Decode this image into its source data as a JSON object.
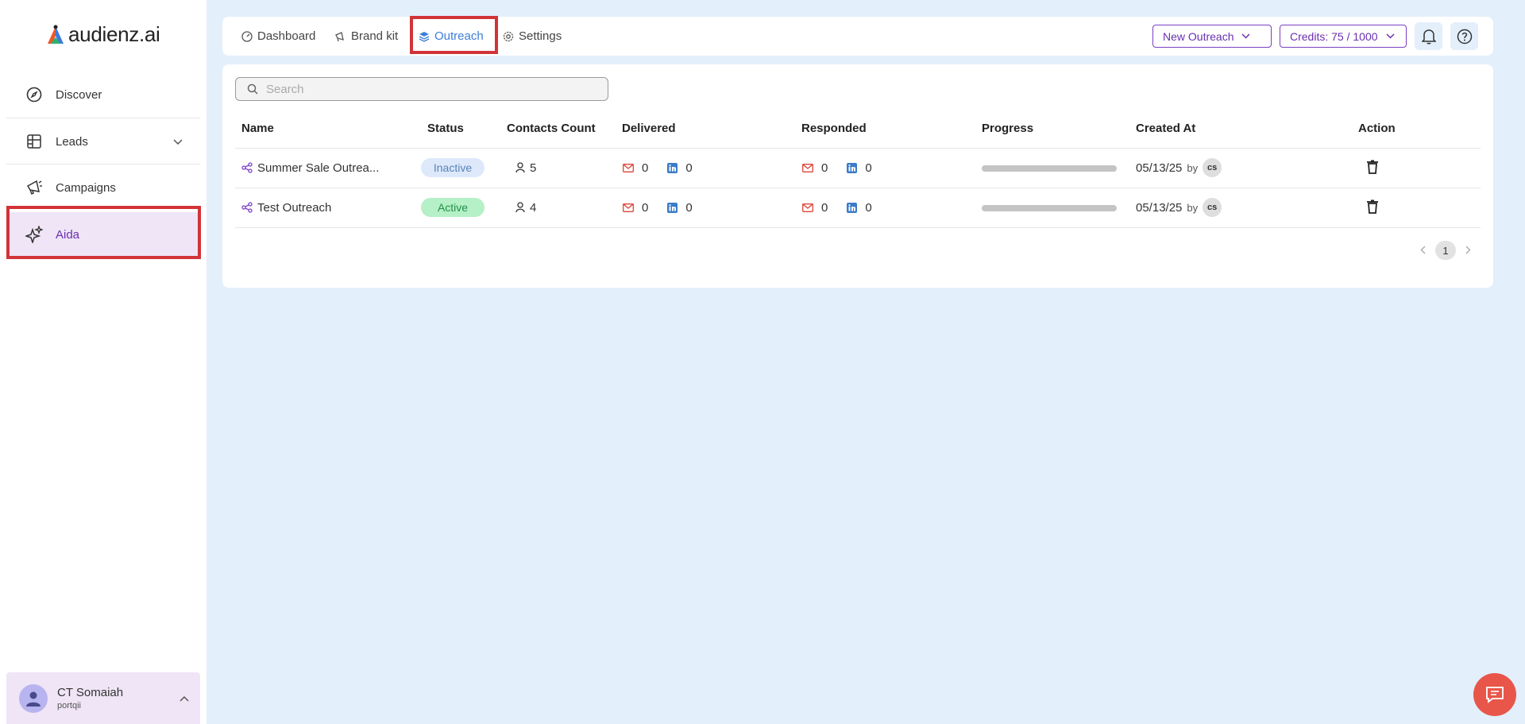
{
  "brand": {
    "name": "audienz.ai"
  },
  "sidebar": {
    "items": [
      {
        "label": "Discover",
        "icon": "compass-icon"
      },
      {
        "label": "Leads",
        "icon": "table-layout-icon"
      },
      {
        "label": "Campaigns",
        "icon": "megaphone-icon"
      },
      {
        "label": "Aida",
        "icon": "sparkles-icon",
        "active": true
      }
    ],
    "user": {
      "name": "CT Somaiah",
      "org": "portqii"
    }
  },
  "topbar": {
    "tabs": [
      {
        "label": "Dashboard",
        "icon": "gauge-icon"
      },
      {
        "label": "Brand kit",
        "icon": "megaphone-icon"
      },
      {
        "label": "Outreach",
        "icon": "layers-icon",
        "active": true
      },
      {
        "label": "Settings",
        "icon": "gear-icon"
      }
    ],
    "new_outreach_label": "New Outreach",
    "credits_label": "Credits: 75 / 1000"
  },
  "search": {
    "placeholder": "Search",
    "value": ""
  },
  "table": {
    "columns": [
      "Name",
      "Status",
      "Contacts Count",
      "Delivered",
      "Responded",
      "Progress",
      "Created At",
      "Action"
    ],
    "rows": [
      {
        "name": "Summer Sale Outrea...",
        "status": "Inactive",
        "contacts": "5",
        "delivered_email": "0",
        "delivered_linkedin": "0",
        "responded_email": "0",
        "responded_linkedin": "0",
        "progress": 0,
        "created_at": "05/13/25",
        "by": "by",
        "initials": "cs"
      },
      {
        "name": "Test Outreach",
        "status": "Active",
        "contacts": "4",
        "delivered_email": "0",
        "delivered_linkedin": "0",
        "responded_email": "0",
        "responded_linkedin": "0",
        "progress": 0,
        "created_at": "05/13/25",
        "by": "by",
        "initials": "cs"
      }
    ]
  },
  "pagination": {
    "current": "1"
  },
  "colors": {
    "accent": "#6a2fb0",
    "active_tab": "#3d7fd9",
    "highlight": "#d13438",
    "chat": "#e8564a"
  }
}
